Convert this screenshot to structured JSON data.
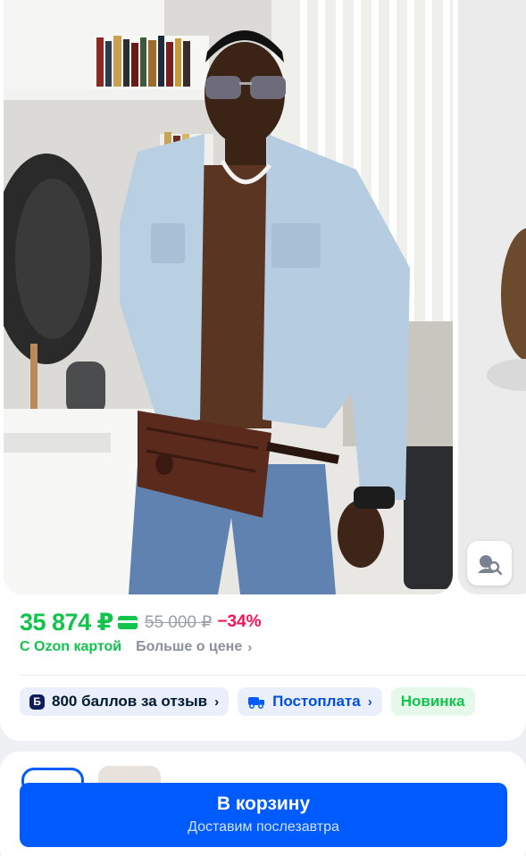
{
  "gallery": {
    "main_photo_alt": "",
    "visual_search_icon": "image-search-icon"
  },
  "price": {
    "current": "35 874 ₽",
    "card_icon": "ozon-card-icon",
    "old": "55 000 ₽",
    "discount": "−34%",
    "ozon_card_label": "С Ozon картой",
    "more_label": "Больше о цене",
    "chevron": "›"
  },
  "chips": {
    "bonus_badge": "Б",
    "bonus_label": "800 баллов за отзыв",
    "postpay_label": "Постоплата",
    "new_label": "Новинка",
    "chevron": "›"
  },
  "cart": {
    "title": "В корзину",
    "subtitle": "Доставим послезавтра"
  },
  "colors": {
    "price_green": "#10c44c",
    "discount_pink": "#f91155",
    "ozon_blue": "#005bff"
  }
}
